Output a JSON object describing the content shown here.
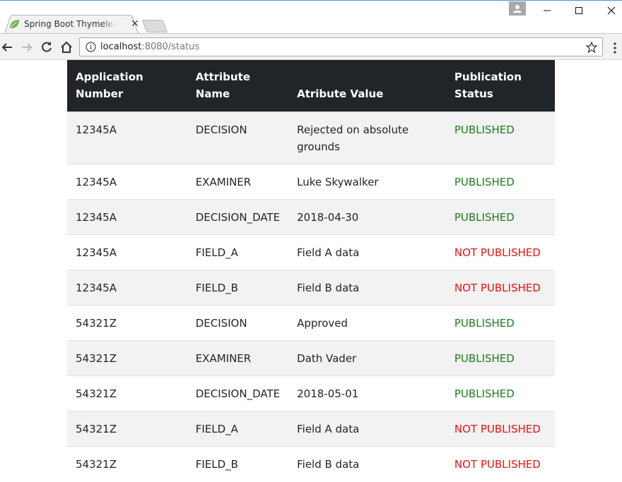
{
  "browser": {
    "tab_title": "Spring Boot Thymeleaf H",
    "url_host": "localhost",
    "url_port_path": ":8080/status"
  },
  "colors": {
    "header_bg": "#212529",
    "published": "#1a7f1a",
    "not_published": "#ee1111"
  },
  "table": {
    "headers": {
      "app_number": "Application Number",
      "attr_name": "Attribute Name",
      "attr_value": "Atribute Value",
      "pub_status": "Publication Status"
    },
    "rows": [
      {
        "app": "12345A",
        "name": "DECISION",
        "value": "Rejected on absolute grounds",
        "status": "PUBLISHED",
        "published": true
      },
      {
        "app": "12345A",
        "name": "EXAMINER",
        "value": "Luke Skywalker",
        "status": "PUBLISHED",
        "published": true
      },
      {
        "app": "12345A",
        "name": "DECISION_DATE",
        "value": "2018-04-30",
        "status": "PUBLISHED",
        "published": true
      },
      {
        "app": "12345A",
        "name": "FIELD_A",
        "value": "Field A data",
        "status": "NOT PUBLISHED",
        "published": false
      },
      {
        "app": "12345A",
        "name": "FIELD_B",
        "value": "Field B data",
        "status": "NOT PUBLISHED",
        "published": false
      },
      {
        "app": "54321Z",
        "name": "DECISION",
        "value": "Approved",
        "status": "PUBLISHED",
        "published": true
      },
      {
        "app": "54321Z",
        "name": "EXAMINER",
        "value": "Dath Vader",
        "status": "PUBLISHED",
        "published": true
      },
      {
        "app": "54321Z",
        "name": "DECISION_DATE",
        "value": "2018-05-01",
        "status": "PUBLISHED",
        "published": true
      },
      {
        "app": "54321Z",
        "name": "FIELD_A",
        "value": "Field A data",
        "status": "NOT PUBLISHED",
        "published": false
      },
      {
        "app": "54321Z",
        "name": "FIELD_B",
        "value": "Field B data",
        "status": "NOT PUBLISHED",
        "published": false
      }
    ]
  }
}
